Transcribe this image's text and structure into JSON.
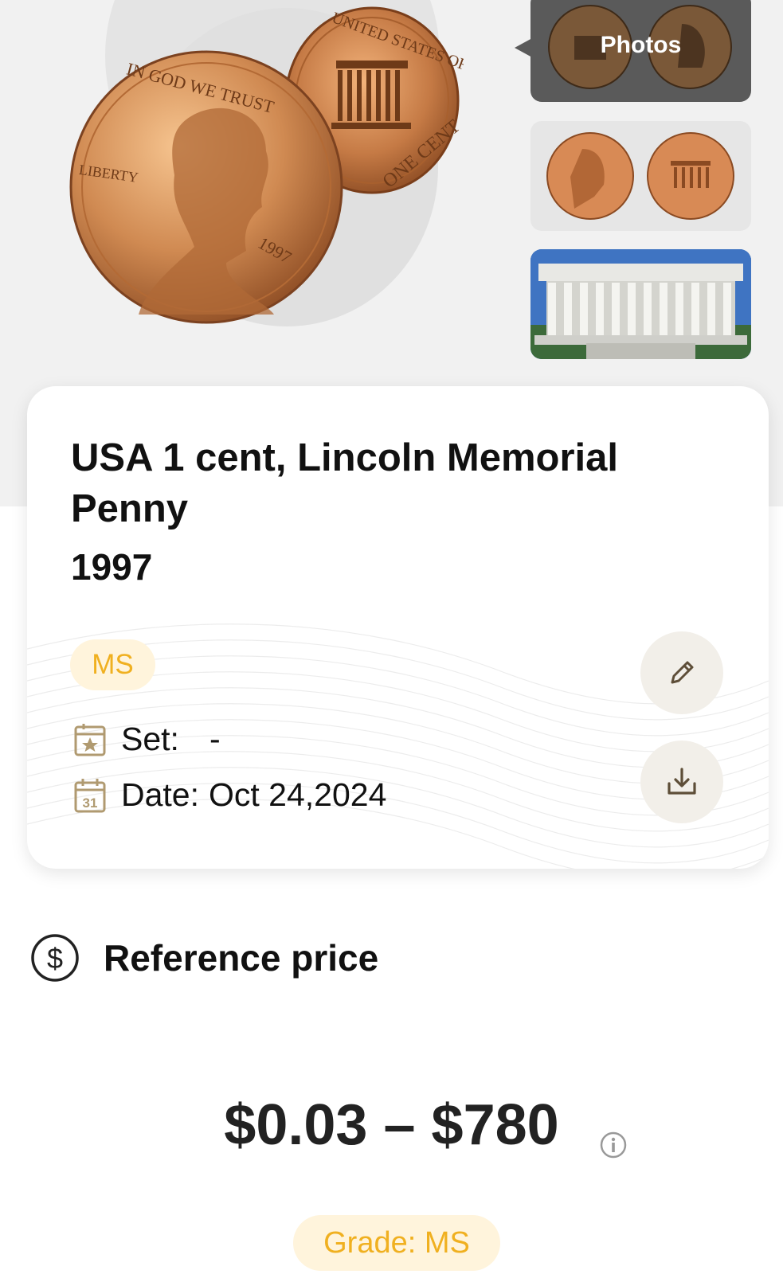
{
  "gallery": {
    "photos_label": "Photos",
    "main_coin_obverse": {
      "legend_top": "IN GOD WE TRUST",
      "legend_left": "LIBERTY",
      "year": "1997"
    },
    "main_coin_reverse": {
      "legend_top": "UNITED STATES OF AMERICA",
      "legend_bottom": "ONE CENT"
    }
  },
  "coin": {
    "title": "USA 1 cent, Lincoln Memorial Penny",
    "year": "1997",
    "grade_badge": "MS",
    "set_label": "Set:",
    "set_value": "-",
    "date_label": "Date:",
    "date_value": "Oct 24,2024"
  },
  "reference_price": {
    "label": "Reference price",
    "range": "$0.03 – $780",
    "grade_pill": "Grade: MS"
  },
  "colors": {
    "accent_gold": "#f0b020",
    "badge_bg": "#fff4dc",
    "icon_brown": "#b09a70"
  },
  "icons": [
    "pencil-icon",
    "download-icon",
    "set-icon",
    "calendar-icon",
    "dollar-circle-icon",
    "info-icon"
  ]
}
